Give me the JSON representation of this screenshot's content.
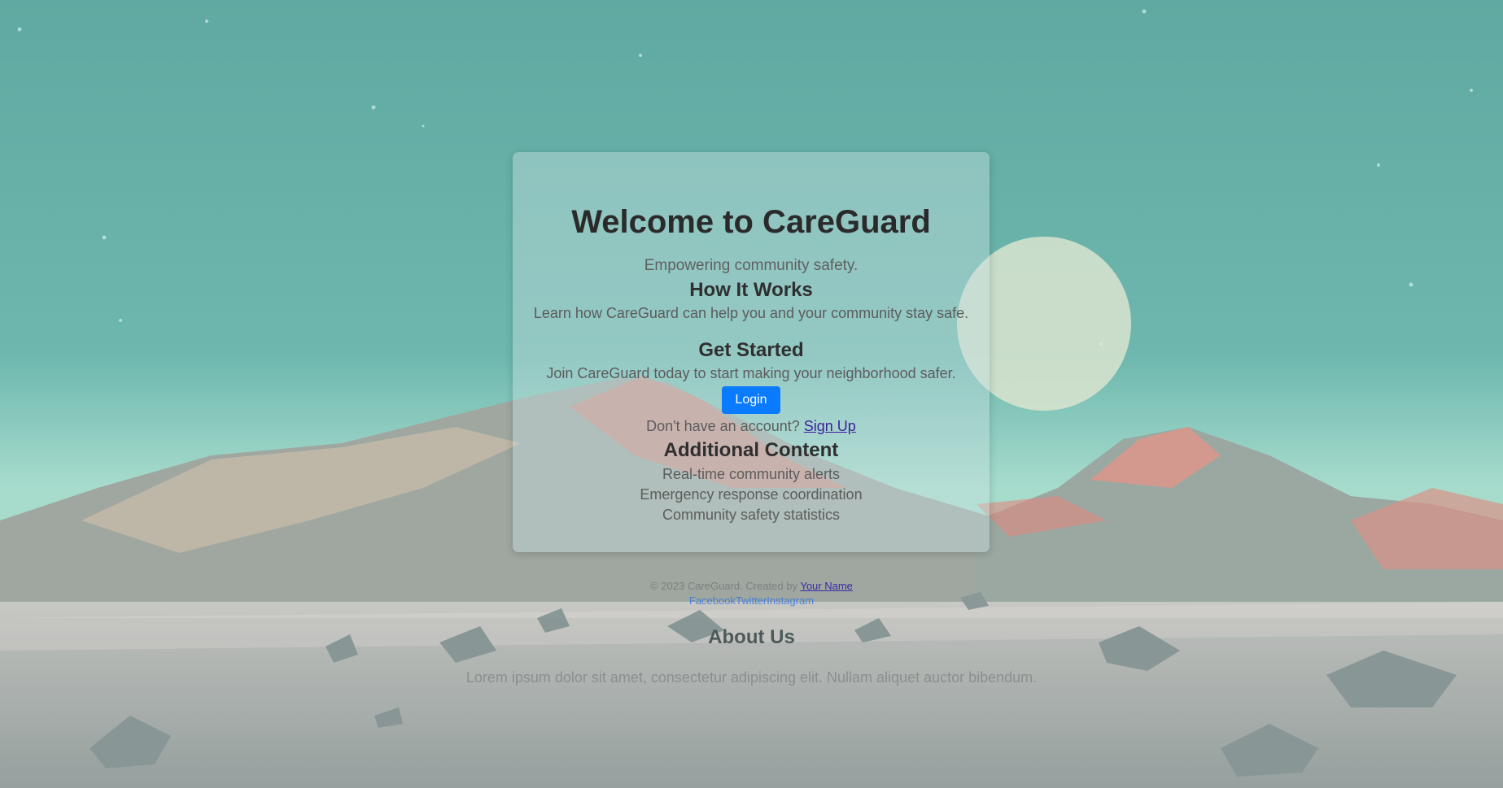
{
  "hero": {
    "title": "Welcome to CareGuard",
    "tagline": "Empowering community safety."
  },
  "how_it_works": {
    "heading": "How It Works",
    "text": "Learn how CareGuard can help you and your community stay safe."
  },
  "get_started": {
    "heading": "Get Started",
    "text": "Join CareGuard today to start making your neighborhood safer.",
    "login_label": "Login",
    "signup_prompt": "Don't have an account?",
    "signup_link": "Sign Up"
  },
  "additional": {
    "heading": "Additional Content",
    "items": [
      "Real-time community alerts",
      "Emergency response coordination",
      "Community safety statistics"
    ]
  },
  "footer": {
    "copyright": "© 2023 CareGuard. Created by",
    "author_link": "Your Name",
    "social": [
      "Facebook",
      "Twitter",
      "Instagram"
    ]
  },
  "about": {
    "heading": "About Us",
    "text": "Lorem ipsum dolor sit amet, consectetur adipiscing elit. Nullam aliquet auctor bibendum."
  },
  "colors": {
    "sky": "#62aea6",
    "button": "#0a7bff",
    "link": "#3b1f9e"
  }
}
